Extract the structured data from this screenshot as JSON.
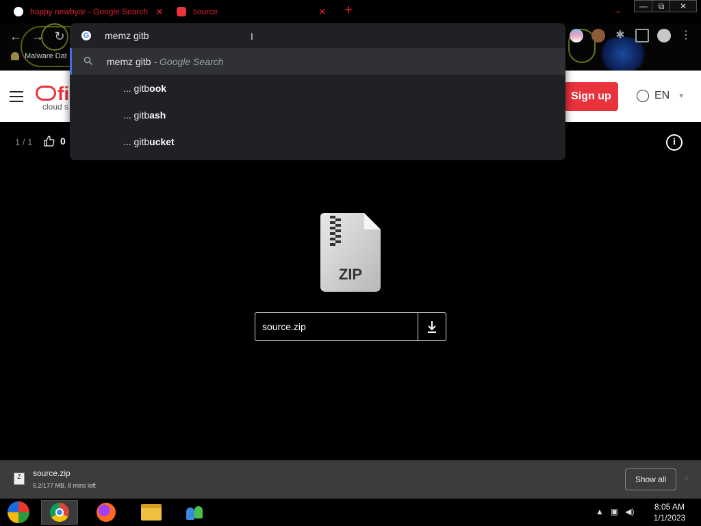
{
  "browser": {
    "tabs": [
      {
        "title": "happy newbyar - Google Search",
        "close": "✕"
      },
      {
        "title": "source",
        "close": "✕"
      }
    ],
    "new_tab": "+",
    "window_controls": {
      "minimize": "—",
      "maximize": "⧉",
      "close": "✕"
    },
    "toolbar": {
      "back": "←",
      "forward": "→",
      "reload": "↻",
      "bookmark_label": "Malware Dat",
      "menu": "⋮"
    }
  },
  "omnibox": {
    "typed": "memz gitb",
    "suggestions": [
      {
        "main": "memz gitb",
        "sub": " - Google Search"
      },
      {
        "prefix": "... gitb",
        "completion": "ook"
      },
      {
        "prefix": "... gitb",
        "completion": "ash"
      },
      {
        "prefix": "... gitb",
        "completion": "ucket"
      }
    ]
  },
  "site": {
    "logo_text": "fi",
    "logo_tagline": "cloud s",
    "signup": "Sign up",
    "language": "EN"
  },
  "viewer": {
    "pager": "1 / 1",
    "likes": "0",
    "info": "i",
    "zip_label": "ZIP",
    "filename": "source.zip"
  },
  "download": {
    "icon_label": "Z",
    "name": "source.zip",
    "status": "5.2/177 MB, 8 mins left",
    "show_all": "Show all"
  },
  "taskbar": {
    "time": "8:05 AM",
    "date": "1/1/2023"
  },
  "colors": {
    "accent_red": "#e8323c",
    "omnibox_bg": "#202124",
    "selection_bar": "#3c6ee6",
    "download_bar": "#3c3c3c"
  }
}
